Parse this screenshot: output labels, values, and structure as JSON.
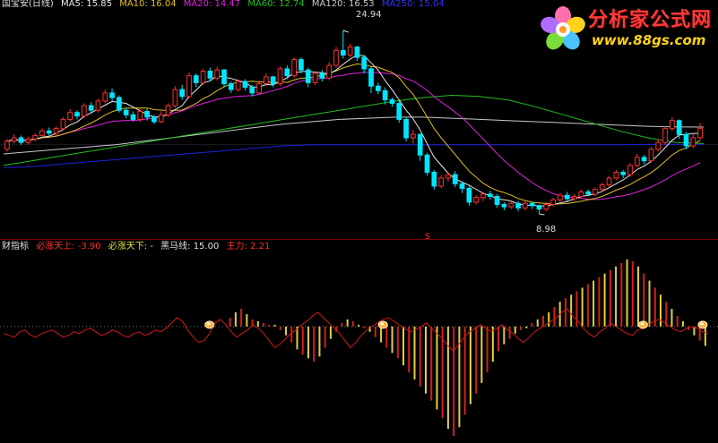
{
  "indicator_legend": {
    "name": "财指标",
    "bizhang_up": "必涨天上: -3.90",
    "bizhang_down": "必涨天下: -",
    "heima": "黑马线: 15.00",
    "zhuli": "主力: 2.21"
  },
  "price_legend": {
    "title": "国宝安(日线)",
    "ma5": "MA5: 15.85",
    "ma10": "MA10: 16.04",
    "ma20": "MA20: 14.47",
    "ma60": "MA60: 12.74",
    "ma120": "MA120: 16.53",
    "ma250": "MA250: 15.04"
  },
  "annotations": {
    "high": "24.94",
    "low": "8.98",
    "s_marker": "S"
  },
  "logo": {
    "title": "分析家公式网",
    "url": "www.88gs.com"
  },
  "colors": {
    "up": "#ff3030",
    "down": "#00e5ff",
    "ma5": "#e8e8e8",
    "ma10": "#e0c020",
    "ma20": "#e020e0",
    "ma60": "#20c020",
    "ma120": "#c8c8c8",
    "ma250": "#2020e0",
    "zhuli_line": "#d01818",
    "bar_red": "#d02020",
    "bar_yellow": "#e0d040"
  },
  "chart_data": [
    {
      "type": "candlestick",
      "y_range": [
        7.5,
        26.5
      ],
      "high_value": 24.94,
      "low_value": 8.98,
      "candles": [
        [
          14.6,
          15.3,
          14.4,
          15.5
        ],
        [
          15.3,
          15.6,
          15.1,
          15.9
        ],
        [
          15.6,
          15.2,
          15.0,
          15.8
        ],
        [
          15.2,
          15.5,
          15.0,
          15.7
        ],
        [
          15.5,
          15.8,
          15.3,
          16.0
        ],
        [
          15.8,
          16.2,
          15.6,
          16.4
        ],
        [
          16.2,
          16.0,
          15.8,
          16.5
        ],
        [
          16.0,
          16.4,
          15.8,
          16.6
        ],
        [
          16.4,
          17.2,
          16.2,
          17.4
        ],
        [
          17.2,
          17.8,
          17.0,
          18.1
        ],
        [
          17.8,
          17.5,
          17.2,
          18.0
        ],
        [
          17.5,
          18.4,
          17.3,
          18.6
        ],
        [
          18.4,
          18.0,
          17.7,
          18.7
        ],
        [
          18.0,
          18.8,
          17.8,
          19.0
        ],
        [
          18.8,
          19.5,
          18.6,
          19.8
        ],
        [
          19.5,
          19.1,
          18.8,
          19.9
        ],
        [
          19.1,
          18.0,
          17.8,
          19.3
        ],
        [
          18.0,
          17.6,
          17.3,
          18.2
        ],
        [
          17.6,
          17.2,
          17.0,
          17.9
        ],
        [
          17.2,
          17.9,
          17.0,
          18.1
        ],
        [
          17.9,
          17.4,
          17.1,
          18.2
        ],
        [
          17.4,
          17.0,
          16.8,
          17.6
        ],
        [
          17.0,
          17.6,
          16.9,
          17.9
        ],
        [
          17.6,
          18.4,
          17.4,
          18.6
        ],
        [
          18.4,
          19.8,
          18.2,
          20.1
        ],
        [
          19.8,
          19.2,
          18.9,
          20.2
        ],
        [
          19.2,
          21.0,
          19.0,
          21.3
        ],
        [
          21.0,
          20.4,
          20.0,
          21.2
        ],
        [
          20.4,
          21.4,
          20.2,
          21.6
        ],
        [
          21.4,
          20.8,
          20.5,
          21.7
        ],
        [
          20.8,
          21.5,
          20.6,
          21.8
        ],
        [
          21.5,
          20.3,
          20.0,
          21.6
        ],
        [
          20.3,
          19.8,
          19.5,
          20.5
        ],
        [
          19.8,
          20.5,
          19.6,
          20.7
        ],
        [
          20.5,
          20.0,
          19.7,
          20.7
        ],
        [
          20.0,
          19.5,
          19.2,
          20.2
        ],
        [
          19.5,
          20.3,
          19.4,
          20.6
        ],
        [
          20.3,
          20.9,
          20.1,
          21.2
        ],
        [
          20.9,
          20.3,
          20.0,
          21.0
        ],
        [
          20.3,
          21.6,
          20.1,
          21.8
        ],
        [
          21.6,
          21.0,
          20.7,
          21.9
        ],
        [
          21.0,
          22.4,
          20.8,
          22.6
        ],
        [
          22.4,
          21.5,
          21.2,
          22.6
        ],
        [
          21.5,
          20.4,
          20.0,
          21.7
        ],
        [
          20.4,
          21.2,
          20.2,
          21.4
        ],
        [
          21.2,
          20.8,
          20.5,
          21.5
        ],
        [
          20.8,
          21.9,
          20.6,
          22.2
        ],
        [
          21.9,
          23.2,
          21.7,
          23.5
        ],
        [
          23.2,
          22.8,
          22.5,
          24.94
        ],
        [
          22.8,
          23.5,
          22.6,
          23.8
        ],
        [
          23.5,
          22.6,
          22.3,
          23.6
        ],
        [
          22.6,
          21.6,
          21.2,
          22.8
        ],
        [
          21.6,
          20.1,
          19.5,
          21.8
        ],
        [
          20.1,
          19.7,
          19.4,
          20.4
        ],
        [
          19.7,
          18.9,
          18.5,
          20.0
        ],
        [
          18.9,
          18.6,
          18.3,
          19.1
        ],
        [
          18.6,
          17.2,
          16.9,
          18.8
        ],
        [
          17.2,
          15.6,
          15.3,
          17.4
        ],
        [
          15.6,
          15.9,
          15.1,
          16.3
        ],
        [
          15.9,
          14.1,
          13.6,
          16.0
        ],
        [
          14.1,
          12.6,
          12.3,
          14.3
        ],
        [
          12.6,
          11.4,
          11.1,
          12.8
        ],
        [
          11.4,
          12.1,
          11.2,
          12.3
        ],
        [
          12.1,
          12.4,
          11.8,
          12.6
        ],
        [
          12.4,
          11.6,
          11.3,
          12.7
        ],
        [
          11.6,
          11.2,
          10.8,
          11.8
        ],
        [
          11.2,
          10.0,
          9.7,
          11.4
        ],
        [
          10.0,
          10.4,
          9.8,
          10.6
        ],
        [
          10.4,
          10.7,
          10.1,
          10.9
        ],
        [
          10.7,
          10.5,
          10.2,
          11.0
        ],
        [
          10.5,
          9.8,
          9.5,
          10.7
        ],
        [
          9.8,
          9.6,
          9.3,
          10.0
        ],
        [
          9.6,
          9.9,
          9.4,
          10.1
        ],
        [
          9.9,
          9.5,
          9.2,
          10.1
        ],
        [
          9.5,
          9.9,
          9.3,
          10.1
        ],
        [
          9.9,
          9.7,
          9.4,
          10.0
        ],
        [
          9.7,
          9.4,
          8.98,
          9.8
        ],
        [
          9.4,
          9.8,
          9.2,
          10.0
        ],
        [
          9.8,
          10.2,
          9.6,
          10.4
        ],
        [
          10.2,
          10.6,
          10.0,
          10.8
        ],
        [
          10.6,
          10.3,
          10.1,
          10.9
        ],
        [
          10.3,
          10.5,
          10.1,
          10.7
        ],
        [
          10.5,
          10.9,
          10.3,
          11.1
        ],
        [
          10.9,
          10.7,
          10.5,
          11.1
        ],
        [
          10.7,
          11.1,
          10.5,
          11.3
        ],
        [
          11.1,
          11.5,
          10.9,
          11.7
        ],
        [
          11.5,
          12.1,
          11.3,
          12.3
        ],
        [
          12.1,
          12.6,
          11.9,
          12.8
        ],
        [
          12.6,
          12.4,
          12.1,
          12.8
        ],
        [
          12.4,
          13.2,
          12.2,
          13.4
        ],
        [
          13.2,
          13.9,
          13.0,
          14.2
        ],
        [
          13.9,
          13.6,
          13.3,
          14.1
        ],
        [
          13.6,
          14.6,
          13.4,
          14.8
        ],
        [
          14.6,
          15.2,
          14.4,
          15.5
        ],
        [
          15.2,
          16.4,
          15.0,
          16.6
        ],
        [
          16.4,
          17.1,
          16.2,
          17.4
        ],
        [
          17.1,
          15.9,
          15.5,
          17.2
        ],
        [
          15.9,
          14.9,
          14.6,
          16.1
        ],
        [
          14.9,
          15.6,
          14.7,
          15.9
        ],
        [
          15.6,
          16.4,
          15.4,
          16.9
        ]
      ],
      "ma60": [
        13.2,
        13.6,
        14.0,
        14.4,
        14.8,
        15.2,
        15.6,
        16.0,
        16.4,
        16.8,
        17.2,
        17.6,
        18.0,
        18.4,
        18.8,
        19.1,
        19.3,
        19.2,
        18.9,
        18.3,
        17.6,
        16.9,
        16.2,
        15.6,
        15.2,
        15.1
      ],
      "ma120": [
        14.2,
        14.4,
        14.6,
        14.8,
        15.0,
        15.3,
        15.6,
        15.9,
        16.2,
        16.5,
        16.8,
        17.0,
        17.2,
        17.3,
        17.4,
        17.4,
        17.3,
        17.2,
        17.1,
        17.0,
        16.9,
        16.8,
        16.7,
        16.6,
        16.55,
        16.53
      ],
      "ma250": [
        13.0,
        13.1,
        13.3,
        13.5,
        13.7,
        13.9,
        14.1,
        14.3,
        14.5,
        14.7,
        14.9,
        15.0,
        15.0,
        15.0,
        15.0,
        15.0,
        15.0,
        15.0,
        15.0,
        15.0,
        15.0,
        15.0,
        15.0,
        15.02,
        15.03,
        15.04
      ]
    },
    {
      "type": "bar",
      "y_range": [
        -65,
        42
      ],
      "bars": [
        [
          0,
          0
        ],
        [
          0,
          0
        ],
        [
          0,
          0
        ],
        [
          0,
          0
        ],
        [
          0,
          0
        ],
        [
          0,
          0
        ],
        [
          0,
          0
        ],
        [
          0,
          0
        ],
        [
          0,
          0
        ],
        [
          0,
          0
        ],
        [
          0,
          0
        ],
        [
          0,
          0
        ],
        [
          0,
          0
        ],
        [
          0,
          0
        ],
        [
          0,
          0
        ],
        [
          0,
          0
        ],
        [
          0,
          0
        ],
        [
          0,
          0
        ],
        [
          0,
          0
        ],
        [
          0,
          0
        ],
        [
          0,
          0
        ],
        [
          0,
          0
        ],
        [
          0,
          0
        ],
        [
          0,
          0
        ],
        [
          0,
          0
        ],
        [
          0,
          0
        ],
        [
          0,
          0
        ],
        [
          0,
          0
        ],
        [
          0,
          0
        ],
        [
          0,
          0
        ],
        [
          0,
          0
        ],
        [
          0,
          0
        ],
        [
          0,
          0
        ],
        [
          0,
          0
        ],
        [
          0,
          0
        ],
        [
          0,
          0
        ],
        [
          0,
          0
        ],
        [
          0,
          0
        ],
        [
          0,
          0
        ],
        [
          0,
          0
        ],
        [
          5,
          0
        ],
        [
          8,
          1
        ],
        [
          10,
          0
        ],
        [
          7,
          1
        ],
        [
          4,
          0
        ],
        [
          3,
          1
        ],
        [
          2,
          0
        ],
        [
          1,
          0
        ],
        [
          1,
          1
        ],
        [
          -2,
          0
        ],
        [
          -5,
          1
        ],
        [
          -9,
          0
        ],
        [
          -13,
          1
        ],
        [
          -16,
          0
        ],
        [
          -18,
          1
        ],
        [
          -20,
          0
        ],
        [
          -17,
          1
        ],
        [
          -12,
          0
        ],
        [
          -7,
          1
        ],
        [
          -3,
          0
        ],
        [
          2,
          0
        ],
        [
          4,
          1
        ],
        [
          3,
          0
        ],
        [
          1,
          1
        ],
        [
          -1,
          0
        ],
        [
          -3,
          1
        ],
        [
          -6,
          0
        ],
        [
          -9,
          1
        ],
        [
          -12,
          0
        ],
        [
          -15,
          1
        ],
        [
          -18,
          0
        ],
        [
          -22,
          1
        ],
        [
          -26,
          0
        ],
        [
          -30,
          1
        ],
        [
          -34,
          0
        ],
        [
          -38,
          1
        ],
        [
          -42,
          0
        ],
        [
          -47,
          1
        ],
        [
          -52,
          0
        ],
        [
          -58,
          1
        ],
        [
          -62,
          0
        ],
        [
          -57,
          1
        ],
        [
          -50,
          0
        ],
        [
          -44,
          1
        ],
        [
          -38,
          0
        ],
        [
          -32,
          1
        ],
        [
          -26,
          0
        ],
        [
          -20,
          1
        ],
        [
          -14,
          0
        ],
        [
          -10,
          1
        ],
        [
          -7,
          0
        ],
        [
          -4,
          1
        ],
        [
          -2,
          0
        ],
        [
          -1,
          1
        ],
        [
          2,
          0
        ],
        [
          4,
          1
        ],
        [
          6,
          0
        ],
        [
          8,
          1
        ],
        [
          11,
          0
        ],
        [
          14,
          1
        ],
        [
          16,
          0
        ],
        [
          18,
          1
        ],
        [
          20,
          0
        ],
        [
          22,
          1
        ],
        [
          24,
          0
        ],
        [
          26,
          1
        ],
        [
          28,
          0
        ],
        [
          30,
          1
        ],
        [
          32,
          0
        ],
        [
          34,
          1
        ],
        [
          36,
          0
        ],
        [
          38,
          1
        ],
        [
          37,
          0
        ],
        [
          34,
          1
        ],
        [
          30,
          0
        ],
        [
          26,
          1
        ],
        [
          22,
          0
        ],
        [
          18,
          1
        ],
        [
          14,
          0
        ],
        [
          10,
          1
        ],
        [
          6,
          0
        ],
        [
          3,
          1
        ],
        [
          -2,
          0
        ],
        [
          -5,
          1
        ],
        [
          -8,
          0
        ],
        [
          -11,
          1
        ]
      ],
      "line": [
        -4,
        -5,
        -6,
        -3,
        -2,
        -5,
        -6,
        -4,
        -3,
        -2,
        -4,
        -6,
        -5,
        -3,
        -4,
        -2,
        -1,
        -3,
        -5,
        -4,
        -2,
        -3,
        -5,
        -6,
        -4,
        -3,
        -5,
        -4,
        -2,
        -3,
        -1,
        2,
        5,
        3,
        -2,
        -6,
        -9,
        -8,
        -4,
        2,
        4,
        1,
        -3,
        -6,
        -4,
        -2,
        1,
        -1,
        -4,
        -8,
        -12,
        -10,
        -7,
        -4,
        -2,
        1,
        3,
        6,
        8,
        5,
        2,
        -1,
        -4,
        -8,
        -12,
        -9,
        -5,
        -2,
        0,
        2,
        4,
        5,
        3,
        1,
        -1,
        -3,
        -2,
        0,
        2,
        -1,
        -4,
        -7,
        -11,
        -14,
        -10,
        -6,
        -3,
        -1,
        1,
        -1,
        -3,
        -1,
        1,
        -2,
        -4,
        -7,
        -9,
        -6,
        -3,
        -1,
        1,
        3,
        5,
        8,
        10,
        6,
        3,
        -1,
        -4,
        -6,
        -3,
        -1,
        2,
        0,
        -2,
        -4,
        -5,
        -2,
        -1,
        1,
        3,
        4,
        2,
        0,
        -2,
        -3,
        -1,
        0,
        -1,
        -3,
        -4
      ],
      "markers": [
        38,
        70,
        118,
        129,
        137,
        163,
        182
      ]
    }
  ]
}
